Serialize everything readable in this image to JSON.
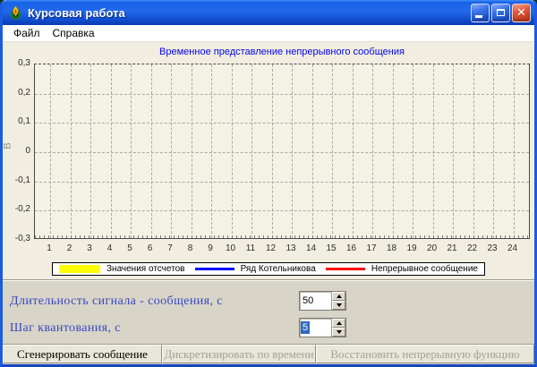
{
  "window": {
    "title": "Курсовая работа",
    "controls": {
      "minimize": "minimize",
      "maximize": "maximize",
      "close": "close"
    }
  },
  "menu": {
    "items": [
      {
        "label": "Файл"
      },
      {
        "label": "Справка"
      }
    ]
  },
  "chart_data": {
    "type": "line",
    "title": "Временное представление непрерывного сообщения",
    "title_color": "#0404EE",
    "xlabel": "",
    "ylabel": "В",
    "ylim": [
      -0.3,
      0.3
    ],
    "xlim": [
      0.25,
      24.85
    ],
    "grid": "dashed",
    "x_ticks": [
      1,
      2,
      3,
      4,
      5,
      6,
      7,
      8,
      9,
      10,
      11,
      12,
      13,
      14,
      15,
      16,
      17,
      18,
      19,
      20,
      21,
      22,
      23,
      24
    ],
    "y_ticks": [
      "0,3",
      "0,2",
      "0,1",
      "0",
      "-0,1",
      "-0,2",
      "-0,3"
    ],
    "series": [],
    "legend_position": "bottom",
    "legend": [
      {
        "label": "Значения отсчетов",
        "color": "#FFFF00",
        "swatch": "bar"
      },
      {
        "label": "Ряд Котельникова",
        "color": "#0000FF",
        "swatch": "line"
      },
      {
        "label": "Непрерывное сообщение",
        "color": "#FF0000",
        "swatch": "line"
      }
    ]
  },
  "fields": [
    {
      "label": "Длительность сигнала - сообщения, с",
      "value": "50",
      "selected": false
    },
    {
      "label": "Шаг квантования, с",
      "value": "5",
      "selected": true
    }
  ],
  "toolbar": {
    "buttons": [
      {
        "label": "Сгенерировать сообщение",
        "enabled": true
      },
      {
        "label": "Дискретизировать по времени",
        "enabled": false
      },
      {
        "label": "Восстановить непрерывную функцию",
        "enabled": false
      }
    ]
  },
  "colors": {
    "titlebar_blue": "#1862E6",
    "panel_cream": "#F1EEE1",
    "panel_beige": "#D8D4C8",
    "label_blue": "#3849C0",
    "selection_blue": "#316AC5"
  }
}
